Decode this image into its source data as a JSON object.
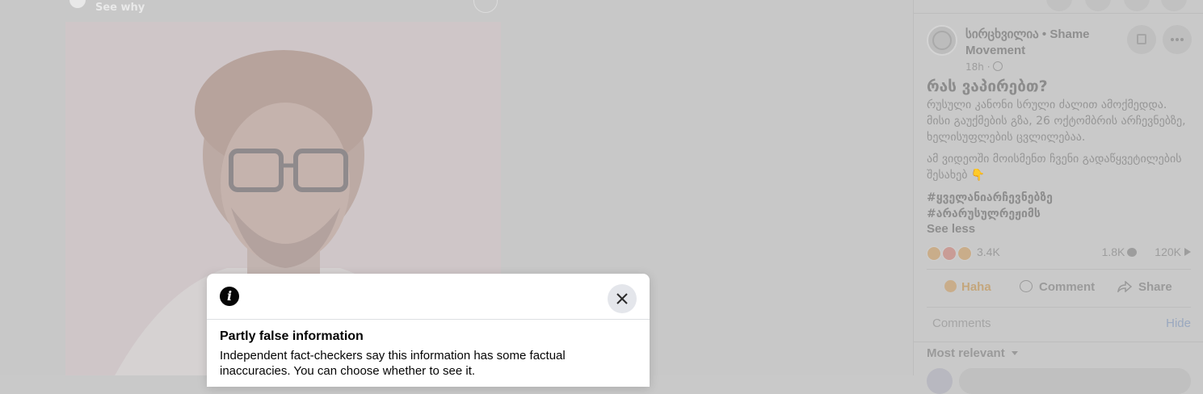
{
  "stage": {
    "see_why": "See why"
  },
  "dialog": {
    "title": "Partly false information",
    "text": "Independent fact-checkers say this information has some factual inaccuracies. You can choose whether to see it."
  },
  "post": {
    "page_name": "სირცხვილია • Shame Movement",
    "time": "18h ·",
    "title": "რას ვაპირებთ?",
    "body": "რუსული კანონი სრული ძალით ამოქმედდა. მისი გაუქმების გზა, 26 ოქტომბრის არჩევნებზე, ხელისუფლების ცვლილებაა.",
    "body2": "ამ ვიდეოში მოისმენთ ჩვენი გადაწყვეტილების შესახებ 👇",
    "hashtag1": "#ყველანიარჩევნებზე",
    "hashtag2": "#არარუსულრეჟიმს",
    "see_less": "See less",
    "reaction_count": "3.4K",
    "comment_count": "1.8K",
    "view_count": "120K"
  },
  "actions": {
    "haha": "Haha",
    "comment": "Comment",
    "share": "Share"
  },
  "comments": {
    "label": "Comments",
    "hide": "Hide",
    "sort": "Most relevant"
  },
  "colors": {
    "overlay": "#c9c9c9",
    "dialog_bg": "#ffffff",
    "haha_accent": "#c4a67c"
  }
}
